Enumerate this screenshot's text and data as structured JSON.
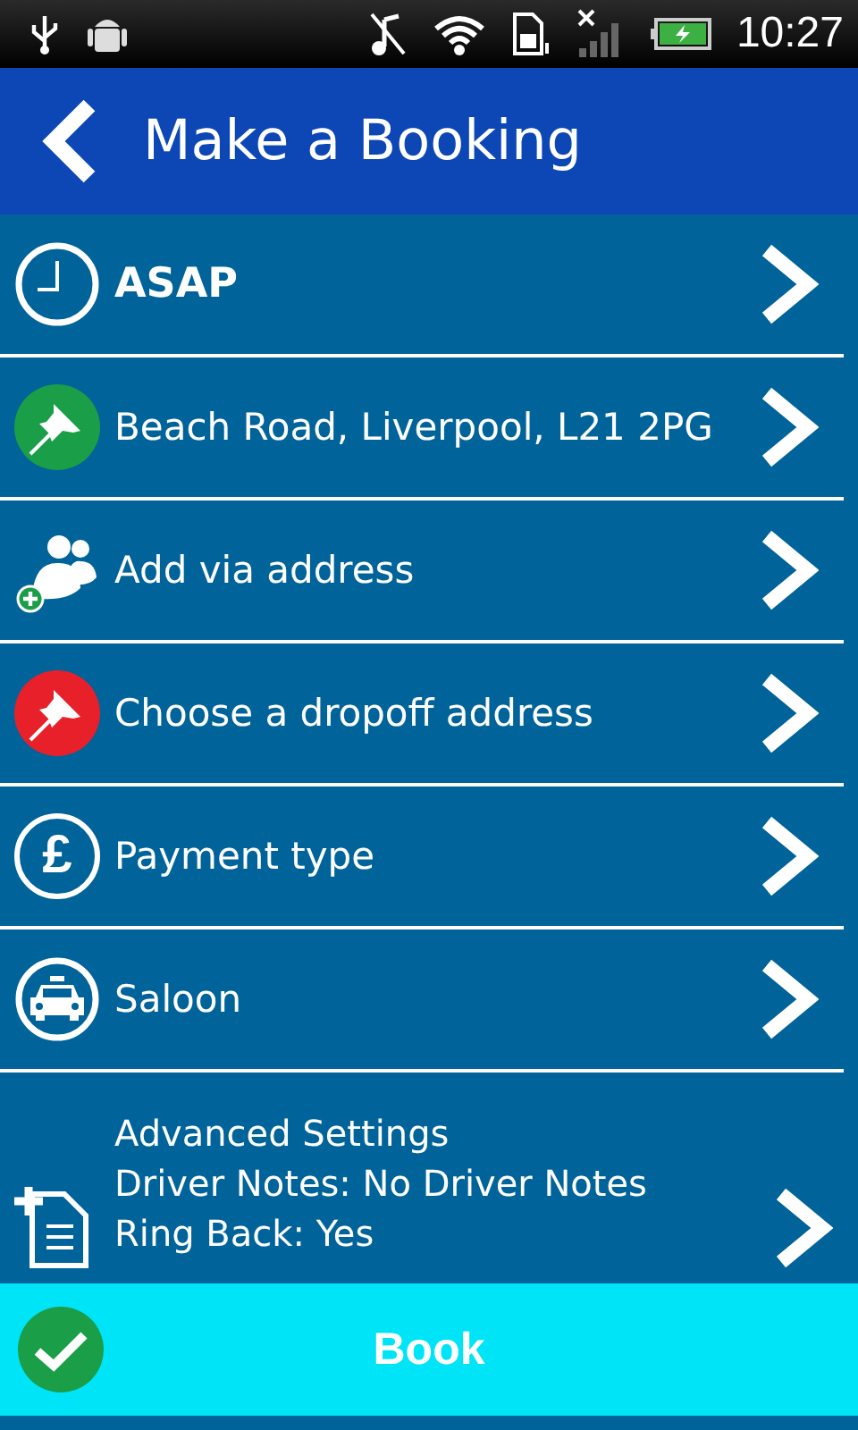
{
  "status_bar": {
    "time": "10:27"
  },
  "header": {
    "title": "Make a Booking"
  },
  "rows": [
    {
      "kind": "clock",
      "label": "ASAP",
      "bold": true
    },
    {
      "kind": "pin",
      "color": "#1a9e48",
      "label": "Beach Road, Liverpool, L21 2PG",
      "bold": false
    },
    {
      "kind": "people-add",
      "label": "Add via address",
      "bold": false
    },
    {
      "kind": "pin",
      "color": "#e8202a",
      "label": "Choose a dropoff address",
      "bold": false
    },
    {
      "kind": "symbol",
      "symbol": "£",
      "label": "Payment type",
      "bold": false
    },
    {
      "kind": "taxi",
      "label": "Saloon",
      "bold": false
    }
  ],
  "advanced": {
    "lines": [
      "Advanced Settings",
      "Driver Notes: No Driver Notes",
      "Ring Back: Yes"
    ]
  },
  "book_button": {
    "label": "Book"
  }
}
